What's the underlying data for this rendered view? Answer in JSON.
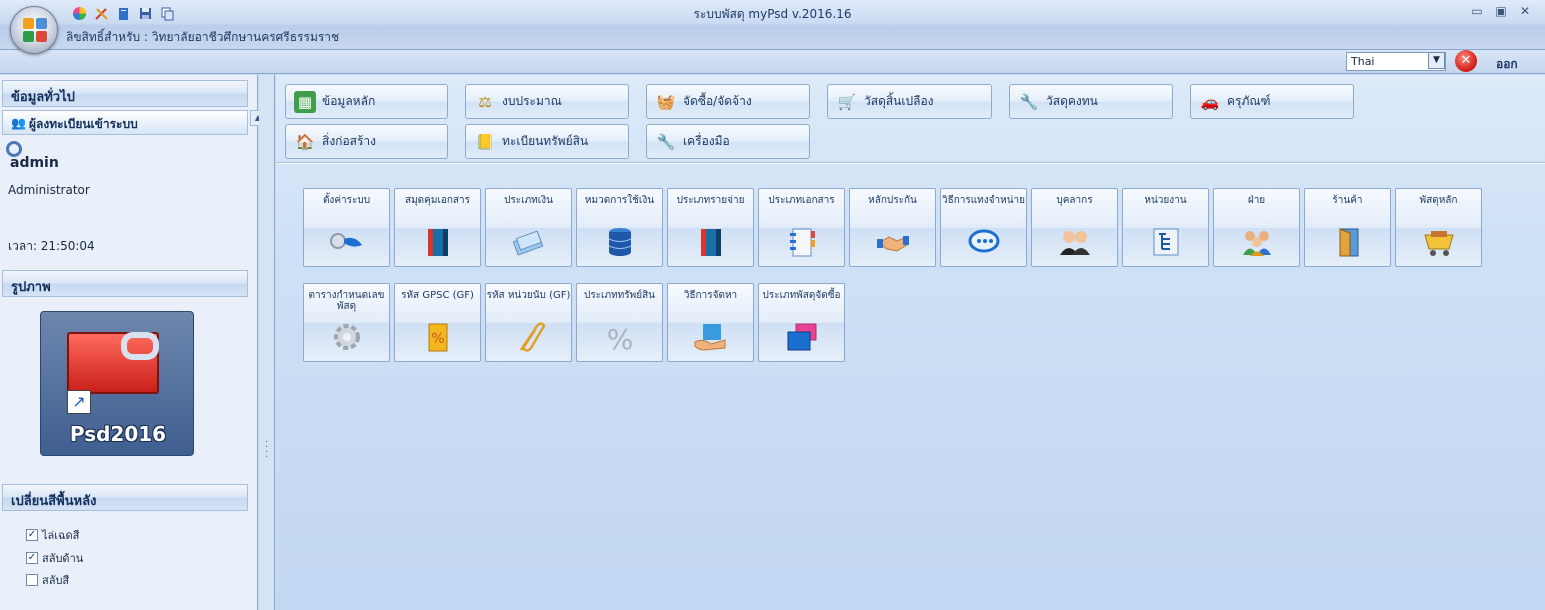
{
  "window": {
    "title": "ระบบพัสดุ myPsd v.2016.16",
    "license": "ลิขสิทธิ์สำหรับ : วิทยาลัยอาชีวศึกษานครศรีธรรมราช",
    "language": "Thai",
    "exit_label": "ออก",
    "controls": {
      "minimize": "▭",
      "restore": "▣",
      "close": "✕"
    }
  },
  "quick_access": [
    "palette-icon",
    "tools-icon",
    "book-icon",
    "save-icon",
    "copy-icon"
  ],
  "left_panel": {
    "general_title": "ข้อมูลทั่วไป",
    "logged_in_title": "ผู้ลงทะเบียนเข้าระบบ",
    "user": "admin",
    "role": "Administrator",
    "time": "เวลา: 21:50:04",
    "picture_title": "รูปภาพ",
    "picture_label": "Psd2016",
    "bg_title": "เปลี่ยนสีพื้นหลัง",
    "options": [
      {
        "label": "ไล่เฉดสี",
        "checked": true
      },
      {
        "label": "สลับด้าน",
        "checked": true
      },
      {
        "label": "สลับสี",
        "checked": false
      }
    ]
  },
  "categories": [
    {
      "label": "ข้อมูลหลัก",
      "icon": "spreadsheet-icon"
    },
    {
      "label": "งบประมาณ",
      "icon": "scale-icon"
    },
    {
      "label": "จัดซื้อ/จัดจ้าง",
      "icon": "basket-icon"
    },
    {
      "label": "วัสดุสิ้นเปลือง",
      "icon": "cart-icon"
    },
    {
      "label": "วัสดุคงทน",
      "icon": "toolbox-icon"
    },
    {
      "label": "ครุภัณฑ์",
      "icon": "car-icon"
    },
    {
      "label": "สิ่งก่อสร้าง",
      "icon": "building-icon"
    },
    {
      "label": "ทะเบียนทรัพย์สิน",
      "icon": "ledger-icon"
    },
    {
      "label": "เครื่องมือ",
      "icon": "wrench-icon"
    }
  ],
  "tiles_row1": [
    {
      "label": "ตั้งค่าระบบ",
      "icon": "key-icon"
    },
    {
      "label": "สมุดคุมเอกสาร",
      "icon": "book-icon"
    },
    {
      "label": "ประเภทเงิน",
      "icon": "money-icon"
    },
    {
      "label": "หมวดการใช้เงิน",
      "icon": "database-icon"
    },
    {
      "label": "ประเภทรายจ่าย",
      "icon": "book-icon"
    },
    {
      "label": "ประเภทเอกสาร",
      "icon": "notebook-icon"
    },
    {
      "label": "หลักประกัน",
      "icon": "handshake-icon"
    },
    {
      "label": "วิธีการแทงจำหน่าย",
      "icon": "chat-icon"
    },
    {
      "label": "บุคลากร",
      "icon": "people-icon"
    },
    {
      "label": "หน่วยงาน",
      "icon": "org-chart-icon"
    },
    {
      "label": "ฝ่าย",
      "icon": "group-icon"
    },
    {
      "label": "ร้านค้า",
      "icon": "door-icon"
    },
    {
      "label": "พัสดุหลัก",
      "icon": "cart-icon"
    }
  ],
  "tiles_row2": [
    {
      "label": "ตารางกำหนดเลขพัสดุ",
      "icon": "gear-icon"
    },
    {
      "label": "รหัส GPSC (GF)",
      "icon": "percent-bag-icon"
    },
    {
      "label": "รหัส หน่วยนับ (GF)",
      "icon": "paperclip-icon"
    },
    {
      "label": "ประเภททรัพย์สิน",
      "icon": "percent-icon"
    },
    {
      "label": "วิธีการจัดหา",
      "icon": "hand-icon"
    },
    {
      "label": "ประเภทพัสดุจัดซื้อ",
      "icon": "windows-icon"
    }
  ]
}
